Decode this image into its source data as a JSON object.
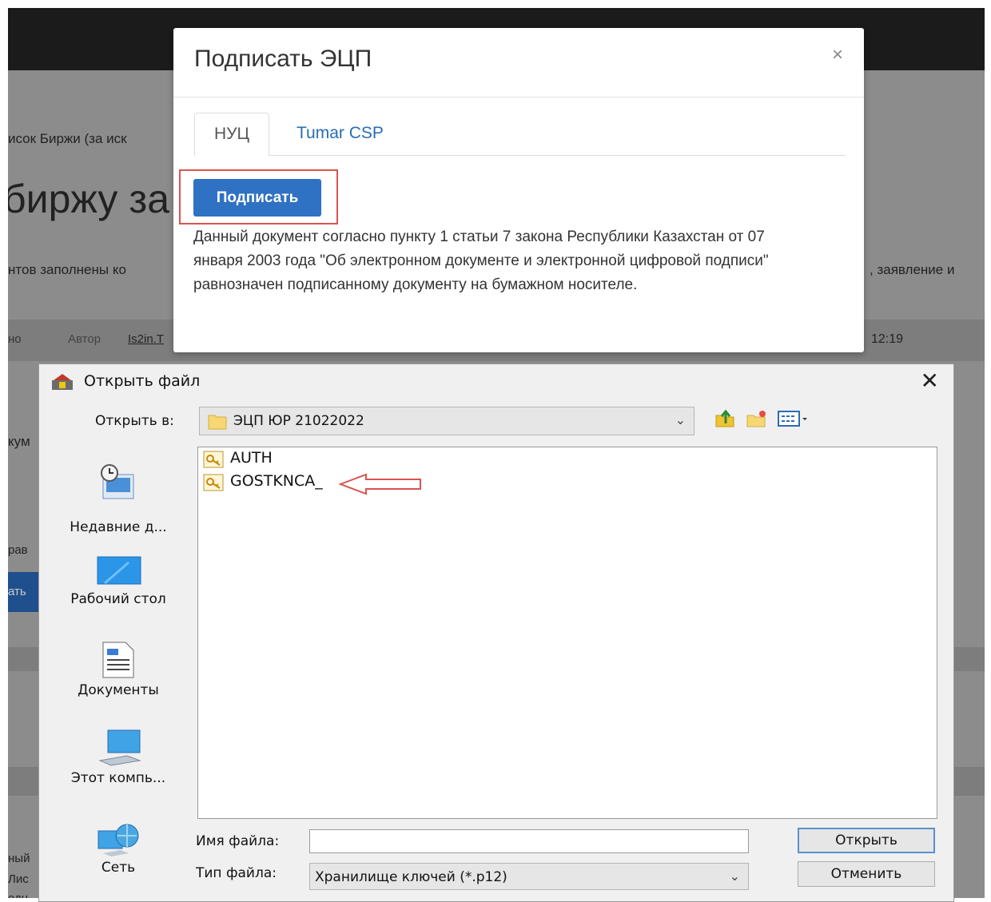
{
  "background": {
    "breadcrumb": "исок Биржи (за иск",
    "heading": "биржу за",
    "line1": "нтов заполнены ко",
    "line1_right": ", заявление и",
    "meta_left": "но",
    "author_label": "Автор",
    "author_link": "Is2in.T",
    "time": "12:19",
    "left_fragments": [
      "кум",
      "рав",
      "ать",
      "ный",
      "Лис",
      "едн"
    ]
  },
  "modal": {
    "title": "Подписать ЭЦП",
    "close": "×",
    "tabs": [
      {
        "label": "НУЦ",
        "active": true
      },
      {
        "label": "Tumar CSP",
        "active": false
      }
    ],
    "sign_button": "Подписать",
    "note": "Данный документ согласно пункту 1 статьи 7 закона Республики Казахстан от 07 января 2003 года \"Об электронном документе и электронной цифровой подписи\" равнозначен подписанному документу на бумажном носителе."
  },
  "dialog": {
    "title": "Открыть файл",
    "close": "✕",
    "look_in_label": "Открыть в:",
    "look_in_value": "ЭЦП ЮР 21022022",
    "places": [
      {
        "label": "Недавние д...",
        "icon": "recent-items-icon"
      },
      {
        "label": "Рабочий стол",
        "icon": "desktop-icon"
      },
      {
        "label": "Документы",
        "icon": "documents-icon"
      },
      {
        "label": "Этот компь...",
        "icon": "this-pc-icon"
      },
      {
        "label": "Сеть",
        "icon": "network-icon"
      }
    ],
    "files": [
      {
        "name": "AUTH",
        "icon": "key-file-icon"
      },
      {
        "name": "GOSTKNCA_",
        "icon": "key-file-icon"
      }
    ],
    "filename_label": "Имя файла:",
    "filename_value": "",
    "filetype_label": "Тип файла:",
    "filetype_value": "Хранилище ключей (*.p12)",
    "open_button": "Открыть",
    "cancel_button": "Отменить"
  },
  "colors": {
    "primary_button": "#2f71c2",
    "highlight_border": "#d9534f",
    "arrow": "#d9534f",
    "tab_link": "#2a6db3"
  }
}
